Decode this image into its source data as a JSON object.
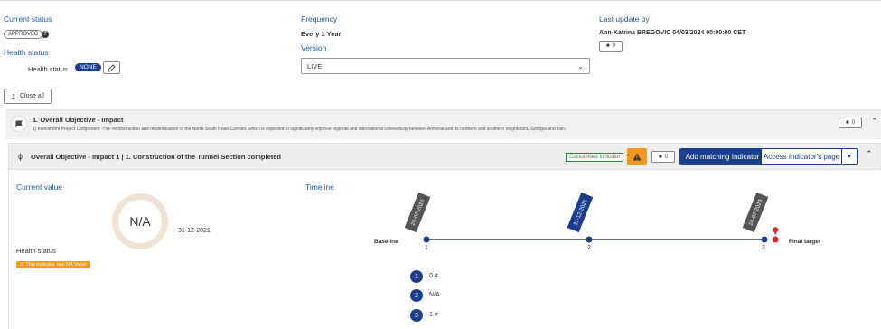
{
  "header": {
    "current_status_label": "Current status",
    "status_value": "APPROVED",
    "help_icon": "?",
    "health_status_title": "Health status",
    "health_status_label": "Health status",
    "health_value": "NONE",
    "frequency_label": "Frequency",
    "frequency_value": "Every 1 Year",
    "version_label": "Version",
    "version_value": "LIVE",
    "last_update_label": "Last update by",
    "last_update_value": "Ann-Katrina BREGOVIC 04/03/2024 00:00:00 CET",
    "comment_count": "0"
  },
  "toolbar": {
    "close_all_label": "Close all"
  },
  "objective": {
    "title": "1. Overall Objective - Impact",
    "description": "1) Investment Project Component -The reconstruction and modernisation of the North-South Road Corridor, which is expected to significantly improve regional and international connectivity between Armenia and its northern and southern neighbours, Georgia and Iran.",
    "comment_count": "0"
  },
  "indicator": {
    "title": "Overall Objective - Impact 1 | 1. Construction of the Tunnel Section completed",
    "custom_tag": "Customised Indicator",
    "comment_count": "0",
    "add_matching_label": "Add matching Indicator",
    "access_page_label": "Access Indicator's page"
  },
  "current_value": {
    "label": "Current value",
    "value": "N/A",
    "date": "31-12-2021",
    "health_label": "Health status",
    "warning": "This indicator has NA Value"
  },
  "timeline": {
    "label": "Timeline",
    "baseline_label": "Baseline",
    "final_label": "Final target",
    "points": [
      {
        "num": "1",
        "date": "24-07-2020",
        "value": "0 #"
      },
      {
        "num": "2",
        "date": "31-12-2021",
        "value": "N/A"
      },
      {
        "num": "3",
        "date": "24-07-2023",
        "value": "1 #"
      }
    ]
  },
  "colors": {
    "brand": "#1b3f8f",
    "warning": "#f29a1b",
    "marker": "#e8252f",
    "flag_dark": "#444444"
  }
}
